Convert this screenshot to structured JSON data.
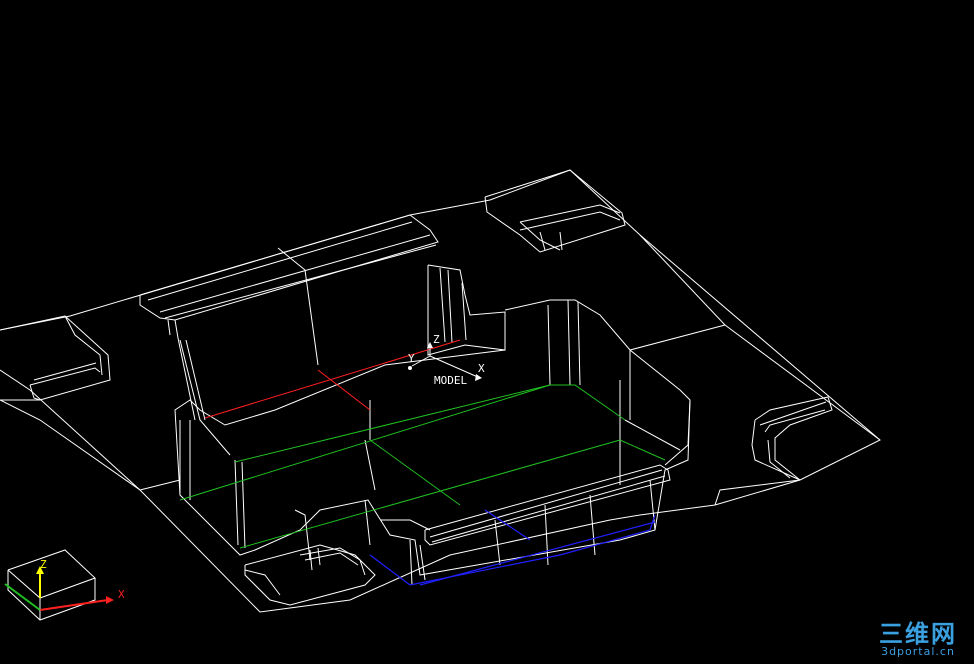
{
  "viewport": {
    "background": "#000000",
    "wire_color": "#ffffff"
  },
  "model_triad": {
    "label": "MODEL",
    "axis_x": "X",
    "axis_y": "Y",
    "axis_z": "Z"
  },
  "orientation_cube": {
    "axis_x": "X",
    "axis_z": "Z",
    "colors": {
      "x": "#ff2020",
      "y": "#20c020",
      "z": "#ffff00"
    }
  },
  "highlight_colors": {
    "red": "#ff2020",
    "green": "#20c020",
    "blue": "#2020ff"
  },
  "watermark": {
    "title": "三维网",
    "subtitle": "3dportal.cn",
    "color": "#3aa0e0"
  }
}
